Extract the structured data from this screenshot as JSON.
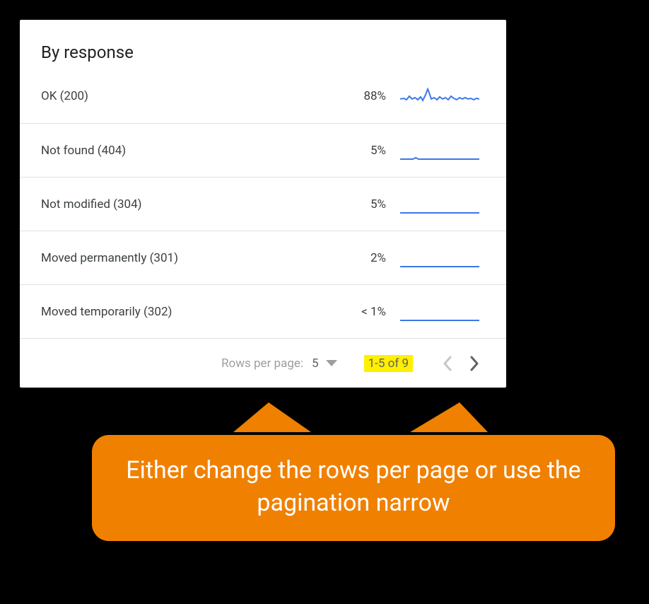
{
  "card": {
    "title": "By response",
    "rows": [
      {
        "label": "OK (200)",
        "pct": "88%"
      },
      {
        "label": "Not found (404)",
        "pct": "5%"
      },
      {
        "label": "Not modified (304)",
        "pct": "5%"
      },
      {
        "label": "Moved permanently (301)",
        "pct": "2%"
      },
      {
        "label": "Moved temporarily (302)",
        "pct": "< 1%"
      }
    ],
    "footer": {
      "rows_per_page_label": "Rows per page:",
      "rows_per_page_value": "5",
      "range": "1-5 of 9"
    }
  },
  "callout": {
    "text": "Either change the rows per page or use the pagination narrow"
  },
  "colors": {
    "spark": "#3b78e7",
    "callout_bg": "#f08000",
    "highlight": "#ffef00"
  },
  "chart_data": [
    {
      "type": "line",
      "label": "OK (200)",
      "percent": 88,
      "series_shape": "high-jitter-with-spike"
    },
    {
      "type": "line",
      "label": "Not found (404)",
      "percent": 5,
      "series_shape": "low-flat-small-bump"
    },
    {
      "type": "line",
      "label": "Not modified (304)",
      "percent": 5,
      "series_shape": "low-flat"
    },
    {
      "type": "line",
      "label": "Moved permanently (301)",
      "percent": 2,
      "series_shape": "low-flat"
    },
    {
      "type": "line",
      "label": "Moved temporarily (302)",
      "percent": 1,
      "series_shape": "low-flat"
    }
  ]
}
